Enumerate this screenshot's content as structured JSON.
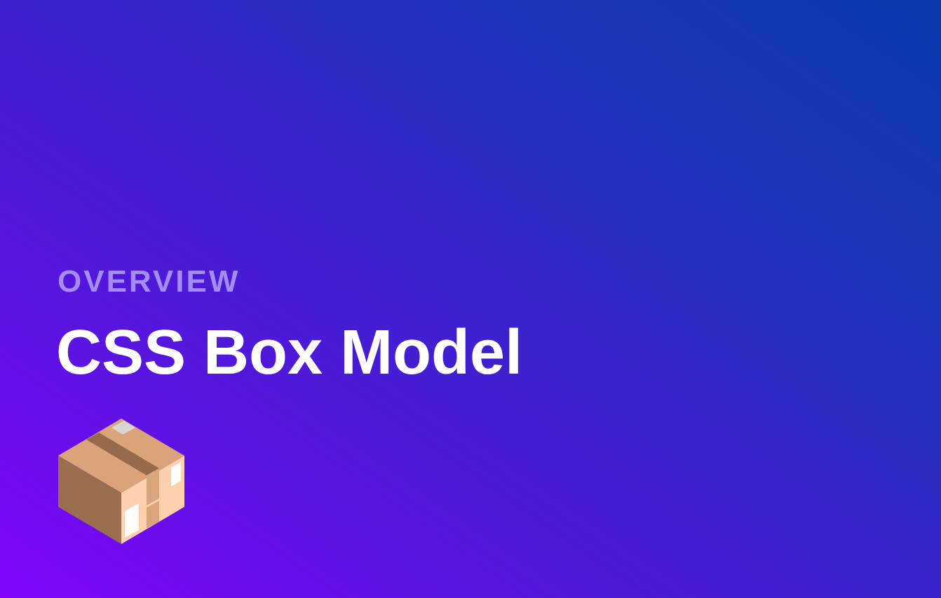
{
  "hero": {
    "eyebrow": "OVERVIEW",
    "title": "CSS Box Model",
    "icon": "package-box-icon"
  },
  "colors": {
    "gradient_start": "#8105fb",
    "gradient_end": "#0a3aab",
    "eyebrow": "#a48cf2",
    "title": "#ffffff",
    "box_top": "#daa37a",
    "box_left": "#9a6e4f",
    "box_right": "#fdd1ad",
    "tape": "#966b4c"
  }
}
